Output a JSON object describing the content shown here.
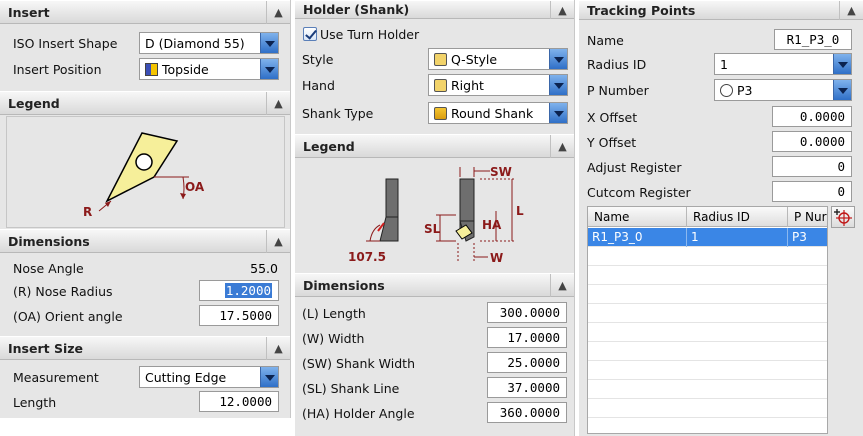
{
  "insert": {
    "title": "Insert",
    "iso_shape_label": "ISO Insert Shape",
    "iso_shape_value": "D (Diamond 55)",
    "position_label": "Insert Position",
    "position_value": "Topside"
  },
  "legend1": {
    "title": "Legend",
    "r_label": "R",
    "oa_label": "OA"
  },
  "dimensions1": {
    "title": "Dimensions",
    "nose_angle_label": "Nose Angle",
    "nose_angle_value": "55.0",
    "nose_radius_label": "(R) Nose Radius",
    "nose_radius_value": "1.2000",
    "orient_label": "(OA) Orient angle",
    "orient_value": "17.5000"
  },
  "insert_size": {
    "title": "Insert Size",
    "measurement_label": "Measurement",
    "measurement_value": "Cutting Edge",
    "length_label": "Length",
    "length_value": "12.0000"
  },
  "holder": {
    "title": "Holder (Shank)",
    "use_turn_holder_label": "Use Turn Holder",
    "style_label": "Style",
    "style_value": "Q-Style",
    "hand_label": "Hand",
    "hand_value": "Right",
    "shank_type_label": "Shank Type",
    "shank_type_value": "Round Shank"
  },
  "legend2": {
    "title": "Legend",
    "angle_label": "107.5",
    "sw_label": "SW",
    "l_label": "L",
    "sl_label": "SL",
    "ha_label": "HA",
    "w_label": "W"
  },
  "dimensions2": {
    "title": "Dimensions",
    "length_label": "(L) Length",
    "length_value": "300.0000",
    "width_label": "(W) Width",
    "width_value": "17.0000",
    "shank_width_label": "(SW) Shank Width",
    "shank_width_value": "25.0000",
    "shank_line_label": "(SL) Shank Line",
    "shank_line_value": "37.0000",
    "holder_angle_label": "(HA) Holder Angle",
    "holder_angle_value": "360.0000"
  },
  "tracking": {
    "title": "Tracking Points",
    "name_label": "Name",
    "name_value": "R1_P3_0",
    "radius_id_label": "Radius ID",
    "radius_id_value": "1",
    "p_number_label": "P Number",
    "p_number_value": "P3",
    "x_offset_label": "X Offset",
    "x_offset_value": "0.0000",
    "y_offset_label": "Y Offset",
    "y_offset_value": "0.0000",
    "adjust_label": "Adjust Register",
    "adjust_value": "0",
    "cutcom_label": "Cutcom Register",
    "cutcom_value": "0",
    "table": {
      "headers": [
        "Name",
        "Radius ID",
        "P Nur"
      ],
      "rows": [
        [
          "R1_P3_0",
          "1",
          "P3"
        ]
      ]
    }
  },
  "icons": {
    "collapse": "chevron-up-icon",
    "add_point": "crosshair-plus-icon"
  },
  "colors": {
    "selection": "#3a86e6",
    "insert_fill": "#f6ef9a",
    "dimension_red": "#8b1a1a"
  }
}
